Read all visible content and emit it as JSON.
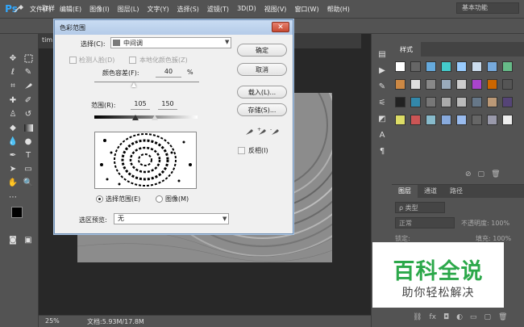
{
  "app": {
    "logo": "Ps"
  },
  "menubar": {
    "items": [
      "文件(F)",
      "编辑(E)",
      "图像(I)",
      "图层(L)",
      "文字(Y)",
      "选择(S)",
      "滤镜(T)",
      "3D(D)",
      "视图(V)",
      "窗口(W)",
      "帮助(H)"
    ]
  },
  "window_controls": {
    "minimize": "—",
    "maximize": "□",
    "close": "✕"
  },
  "options_bar": {
    "tool_label": "取样",
    "workspace": "基本功能"
  },
  "document": {
    "tab_label": "tim",
    "zoom": "25%",
    "doc_size": "文档:5.93M/17.8M"
  },
  "dialog": {
    "title": "色彩范围",
    "select_label": "选择(C):",
    "select_value": "中间调",
    "detect_faces": "检测人脸(D)",
    "localized_clusters": "本地化颜色簇(Z)",
    "fuzziness_label": "颜色容差(F):",
    "fuzziness_value": "40",
    "fuzziness_unit": "%",
    "range_label": "范围(R):",
    "range_low": "105",
    "range_high": "150",
    "radio_selection": "选择范围(E)",
    "radio_image": "图像(M)",
    "preview_label": "选区预览:",
    "preview_value": "无",
    "btn_ok": "确定",
    "btn_cancel": "取消",
    "btn_load": "载入(L)...",
    "btn_save": "存储(S)...",
    "invert_label": "反相(I)",
    "close_glyph": "✕"
  },
  "styles_panel": {
    "tab_label": "样式"
  },
  "layers_panel": {
    "tabs": [
      "图层",
      "通道",
      "路径"
    ],
    "kind_label": "ρ 类型",
    "blend_mode": "正常",
    "opacity_label": "不透明度: 100%",
    "lock_label": "锁定:",
    "fill_label": "填充: 100%"
  },
  "watermark": {
    "title": "百科全说",
    "subtitle": "助你轻松解决",
    "color": "#2ca84a"
  }
}
